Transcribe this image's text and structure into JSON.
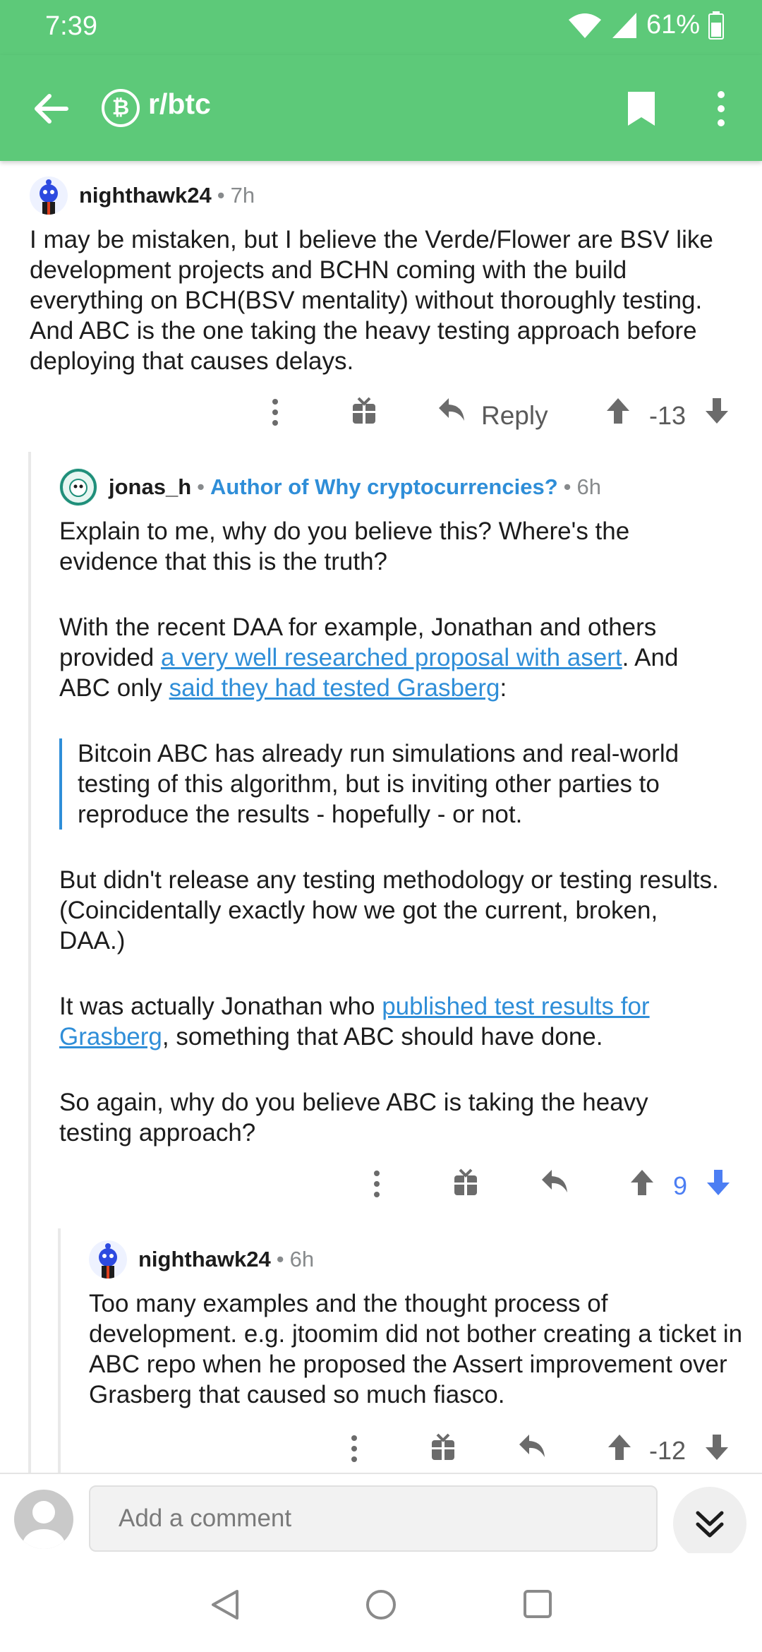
{
  "status_bar": {
    "time": "7:39",
    "battery": "61%"
  },
  "app_bar": {
    "subreddit_icon": "₿",
    "title": "r/btc"
  },
  "comments": [
    {
      "username": "nighthawk24",
      "age": "7h",
      "body": "I may be mistaken, but I believe the Verde/Flower are BSV like development projects and BCHN coming with the build everything on BCH(BSV mentality) without thoroughly testing. And ABC is the one taking the heavy testing approach before deploying that causes delays.",
      "reply_label": "Reply",
      "score": "-13"
    },
    {
      "username": "jonas_h",
      "flair": "Author of Why cryptocurrencies?",
      "age": "6h",
      "p1": "Explain to me, why do you believe this? Where's the evidence that this is the truth?",
      "p2_a": "With the recent DAA for example, Jonathan and others provided ",
      "p2_link1": "a very well researched proposal with asert",
      "p2_b": ". And ABC only ",
      "p2_link2": "said they had tested Grasberg",
      "p2_c": ":",
      "quote": "Bitcoin ABC has already run simulations and real-world testing of this algorithm, but is inviting other parties to reproduce the results - hopefully - or not.",
      "p3": "But didn't release any testing methodology or testing results. (Coincidentally exactly how we got the current, broken, DAA.)",
      "p4_a": "It was actually Jonathan who ",
      "p4_link": "published test results for Grasberg",
      "p4_b": ", something that ABC should have done.",
      "p5": "So again, why do you believe ABC is taking the heavy testing approach?",
      "score": "9"
    },
    {
      "username": "nighthawk24",
      "age": "6h",
      "body": "Too many examples and the thought process of development. e.g. jtoomim did not bother creating a ticket in ABC repo when he proposed the Assert improvement over Grasberg that caused so much fiasco.",
      "score": "-12"
    }
  ],
  "composer": {
    "placeholder": "Add a comment"
  },
  "colors": {
    "accent_green": "#5dc979",
    "link_blue": "#2f8ed8",
    "upvoted_blue": "#4c7ef3"
  }
}
